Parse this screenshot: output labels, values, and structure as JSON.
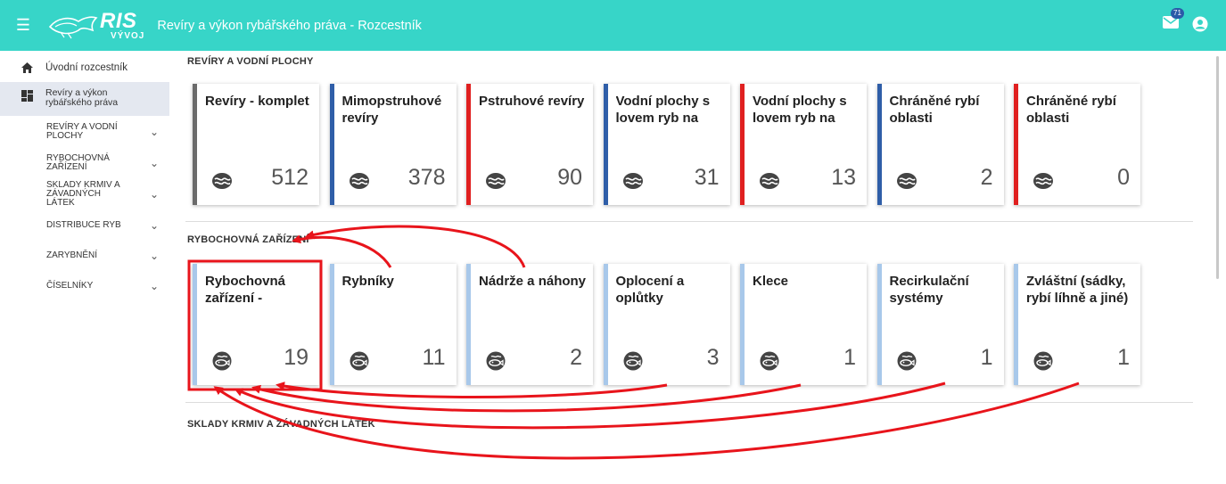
{
  "header": {
    "logo_text": "RIS",
    "logo_sub": "VÝVOJ",
    "title": "Revíry a výkon rybářského práva - Rozcestník",
    "mail_count": "71"
  },
  "sidebar": {
    "home": "Úvodní rozcestník",
    "active": "Revíry a výkon rybářského práva",
    "items": [
      {
        "label": "REVÍRY A VODNÍ PLOCHY"
      },
      {
        "label": "RYBOCHOVNÁ ZAŘÍZENÍ"
      },
      {
        "label": "SKLADY KRMIV A ZÁVADNÝCH LÁTEK"
      },
      {
        "label": "DISTRIBUCE RYB"
      },
      {
        "label": "ZARYBNĚNÍ"
      },
      {
        "label": "ČÍSELNÍKY"
      }
    ]
  },
  "sections": [
    {
      "title": "REVÍRY A VODNÍ PLOCHY",
      "tiles": [
        {
          "title": "Revíry - komplet",
          "count": "512",
          "color": "#6b6b6b",
          "icon": "fish-water-icon"
        },
        {
          "title": "Mimopstruhové revíry",
          "count": "378",
          "color": "#2f5ea8",
          "icon": "fish-water-icon"
        },
        {
          "title": "Pstruhové revíry",
          "count": "90",
          "color": "#e02020",
          "icon": "fish-water-icon"
        },
        {
          "title": "Vodní plochy s lovem ryb na",
          "count": "31",
          "color": "#2f5ea8",
          "icon": "fish-water-icon"
        },
        {
          "title": "Vodní plochy s lovem ryb na",
          "count": "13",
          "color": "#e02020",
          "icon": "fish-water-icon"
        },
        {
          "title": "Chráněné rybí oblasti",
          "count": "2",
          "color": "#2f5ea8",
          "icon": "fish-water-icon"
        },
        {
          "title": "Chráněné rybí oblasti",
          "count": "0",
          "color": "#e02020",
          "icon": "fish-water-icon"
        }
      ]
    },
    {
      "title": "RYBOCHOVNÁ ZAŘÍZENÍ",
      "tiles": [
        {
          "title": "Rybochovná zařízení -",
          "count": "19",
          "color": "#a8c8ea",
          "icon": "fish-farm-icon"
        },
        {
          "title": "Rybníky",
          "count": "11",
          "color": "#a8c8ea",
          "icon": "fish-farm-icon"
        },
        {
          "title": "Nádrže a náhony",
          "count": "2",
          "color": "#a8c8ea",
          "icon": "fish-farm-icon"
        },
        {
          "title": "Oplocení a oplůtky",
          "count": "3",
          "color": "#a8c8ea",
          "icon": "fish-farm-icon"
        },
        {
          "title": "Klece",
          "count": "1",
          "color": "#a8c8ea",
          "icon": "fish-farm-icon"
        },
        {
          "title": "Recirkulační systémy",
          "count": "1",
          "color": "#a8c8ea",
          "icon": "fish-farm-icon"
        },
        {
          "title": "Zvláštní (sádky, rybí líhně a jiné)",
          "count": "1",
          "color": "#a8c8ea",
          "icon": "fish-farm-icon"
        }
      ]
    },
    {
      "title": "SKLADY KRMIV A ZÁVADNÝCH LÁTEK",
      "tiles": []
    }
  ],
  "annotation_color": "#e8141b"
}
